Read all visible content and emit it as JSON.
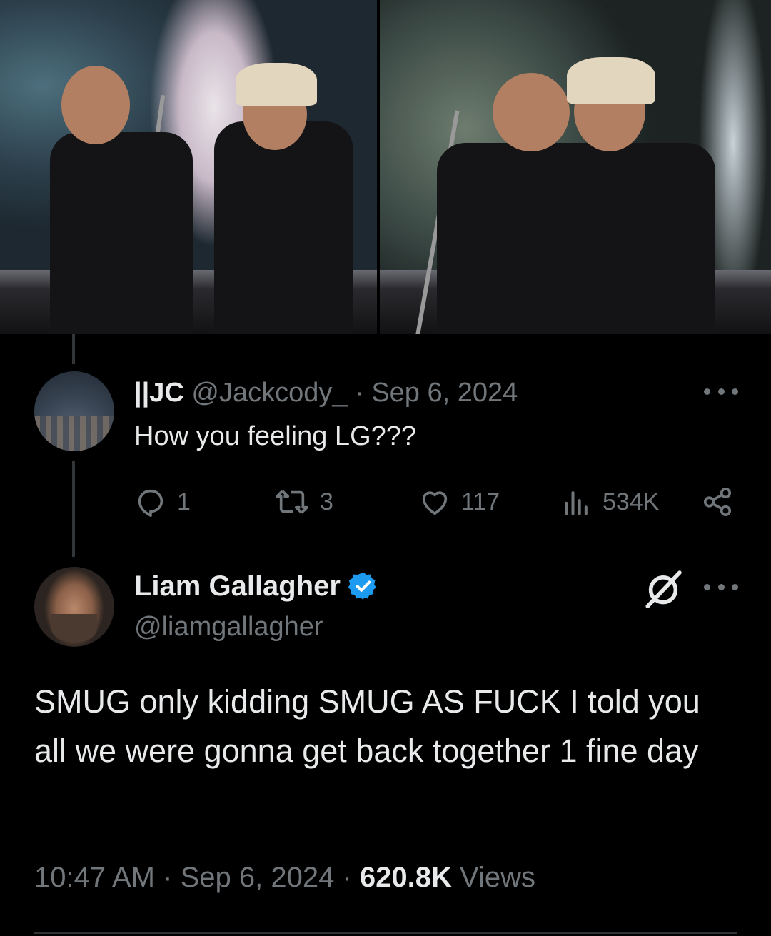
{
  "parent_tweet": {
    "display_name": "||JC",
    "handle": "@Jackcody_",
    "separator": "·",
    "date": "Sep 6, 2024",
    "text": "How you feeling LG???",
    "replies": "1",
    "reposts": "3",
    "likes": "117",
    "views": "534K",
    "icons": [
      "reply-icon",
      "repost-icon",
      "like-icon",
      "views-icon",
      "share-icon",
      "more-icon"
    ]
  },
  "main_tweet": {
    "display_name": "Liam Gallagher",
    "handle": "@liamgallagher",
    "text": "SMUG only kidding SMUG AS FUCK I told you all we were gonna get back together 1 fine day",
    "time": "10:47 AM",
    "separator": "·",
    "date": "Sep 6, 2024",
    "views_count": "620.8K",
    "views_label": "Views",
    "icons": [
      "verified-badge-icon",
      "grok-icon",
      "more-icon"
    ]
  },
  "colors": {
    "background": "#000000",
    "text": "#e7e9ea",
    "secondary": "#71767b",
    "verified": "#1d9bf0"
  }
}
